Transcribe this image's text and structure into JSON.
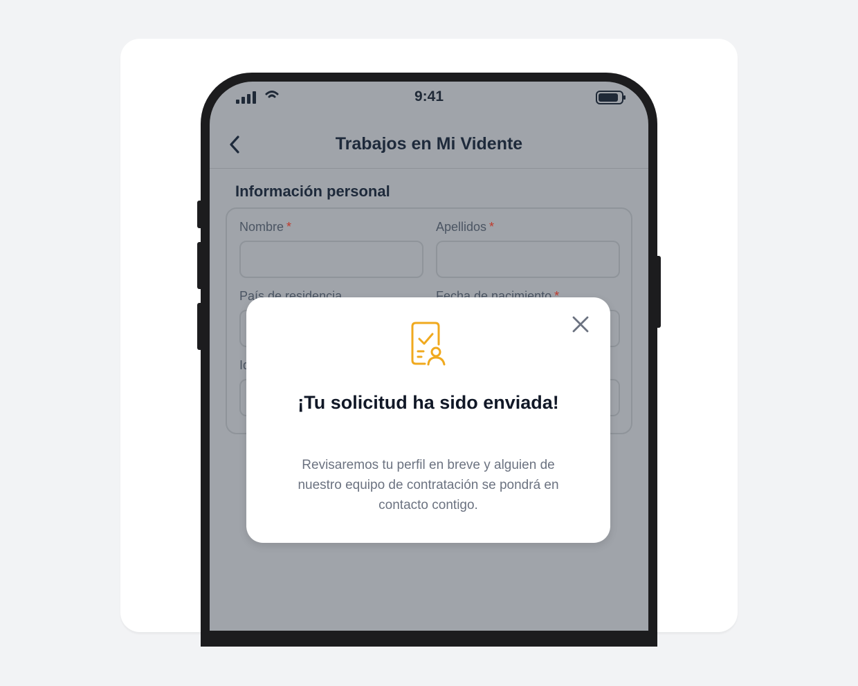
{
  "status_bar": {
    "time": "9:41",
    "signal_icon": "cellular-signal-icon",
    "wifi_icon": "wifi-icon",
    "battery_icon": "battery-icon"
  },
  "nav": {
    "back_icon": "chevron-left-icon",
    "title": "Trabajos en Mi Vidente"
  },
  "section": {
    "title": "Información personal"
  },
  "form": {
    "fields": [
      {
        "label": "Nombre",
        "required": "*",
        "value": ""
      },
      {
        "label": "Apellidos",
        "required": "*",
        "value": ""
      },
      {
        "label": "País de residencia",
        "required": "",
        "value": ""
      },
      {
        "label": "Fecha de nacimiento",
        "required": "*",
        "value": ""
      },
      {
        "label": "Id",
        "required": "",
        "value": ""
      }
    ]
  },
  "modal": {
    "icon": "document-check-person-icon",
    "close_icon": "close-icon",
    "title": "¡Tu solicitud ha sido enviada!",
    "description": "Revisaremos tu perfil en breve y alguien de nuestro equipo de contratación se pondrá en contacto contigo."
  },
  "colors": {
    "accent": "#f0a91e",
    "overlay": "#a0a4aa",
    "title_text": "#1e2a3b",
    "required": "#c0392b"
  }
}
